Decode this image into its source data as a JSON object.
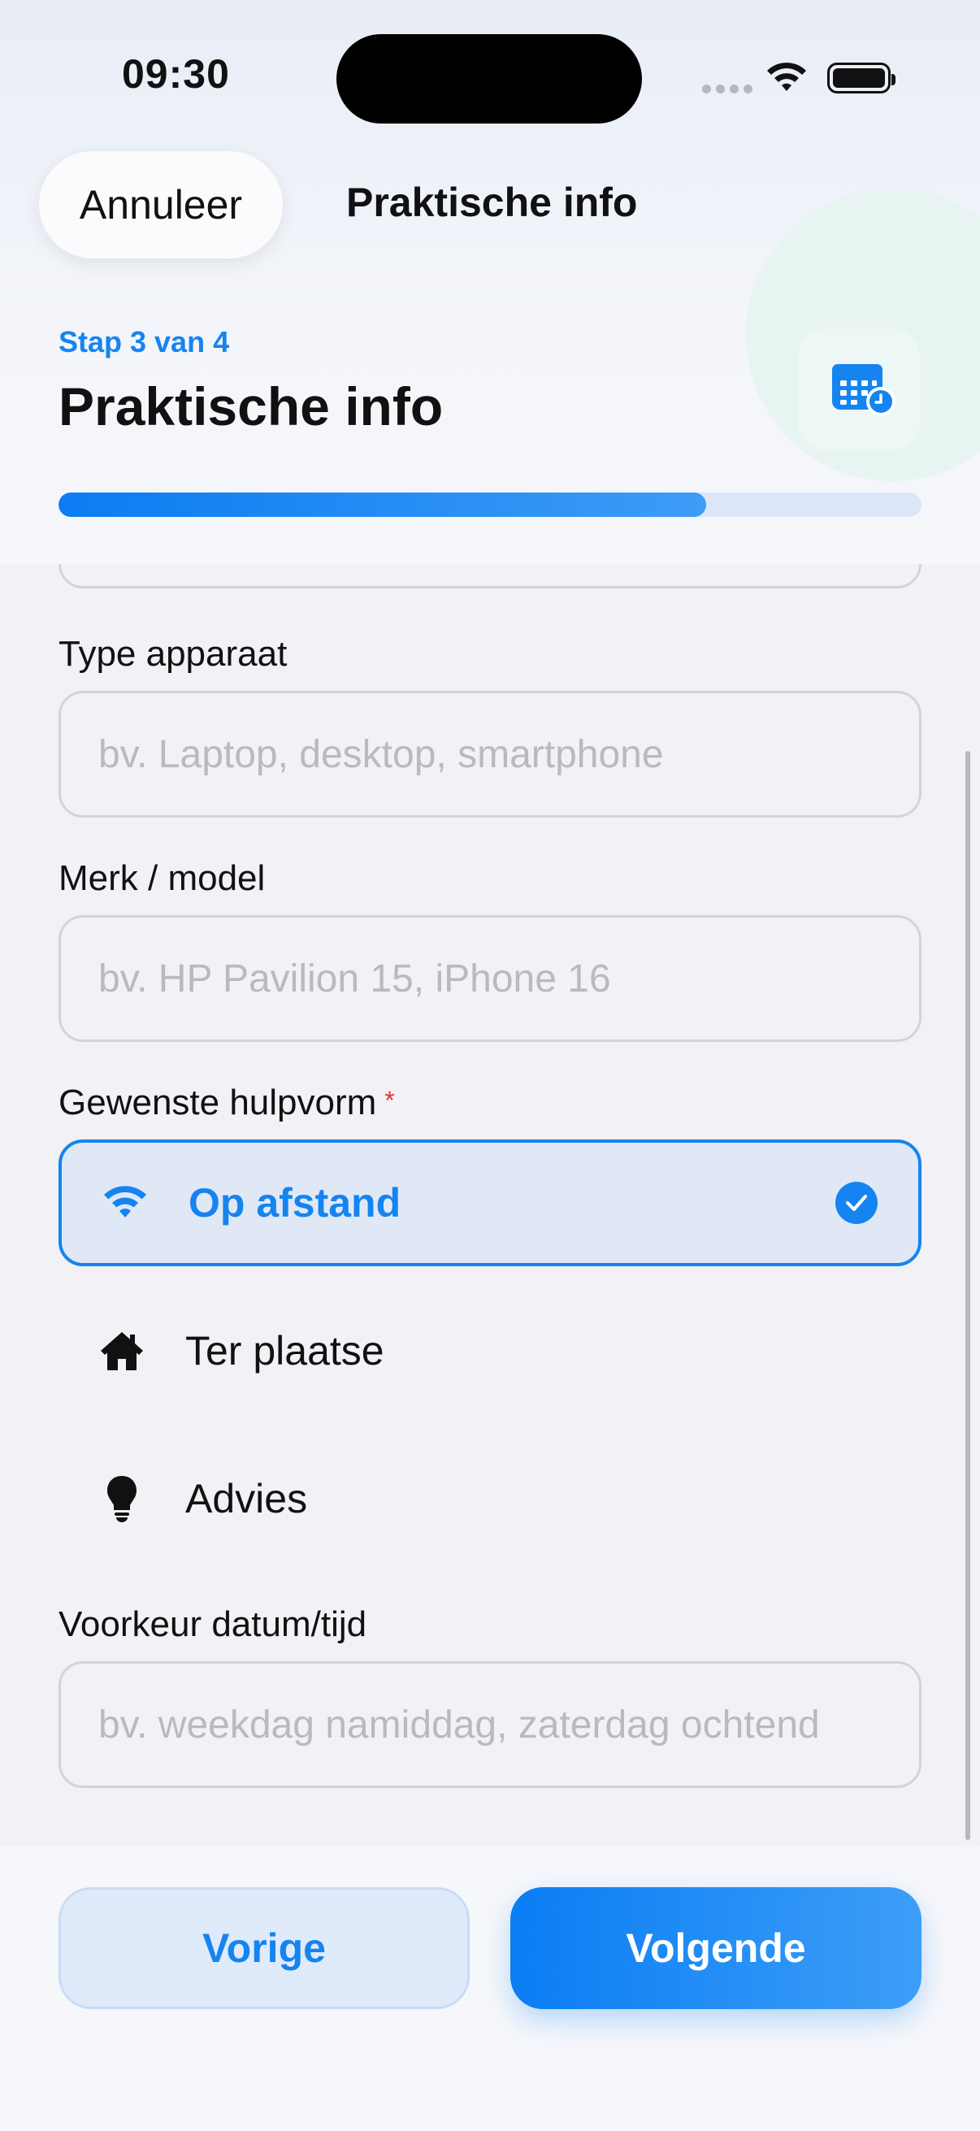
{
  "status_bar": {
    "time": "09:30"
  },
  "nav": {
    "cancel_label": "Annuleer",
    "title": "Praktische info"
  },
  "header": {
    "step_label": "Stap 3 van 4",
    "page_title": "Praktische info",
    "progress_fraction": 0.75,
    "icon": "calendar-clock-icon",
    "accent_color": "#1584F0"
  },
  "form": {
    "device_type": {
      "label": "Type apparaat",
      "placeholder": "bv. Laptop, desktop, smartphone",
      "value": ""
    },
    "brand_model": {
      "label": "Merk / model",
      "placeholder": "bv. HP Pavilion 15, iPhone 16",
      "value": ""
    },
    "help_type": {
      "label": "Gewenste hulpvorm",
      "required_marker": "*",
      "options": [
        {
          "label": "Op afstand",
          "icon": "wifi-icon",
          "selected": true
        },
        {
          "label": "Ter plaatse",
          "icon": "house-icon",
          "selected": false
        },
        {
          "label": "Advies",
          "icon": "lightbulb-icon",
          "selected": false
        }
      ]
    },
    "preferred_time": {
      "label": "Voorkeur datum/tijd",
      "placeholder": "bv. weekdag namiddag, zaterdag ochtend",
      "value": ""
    }
  },
  "footer": {
    "prev_label": "Vorige",
    "next_label": "Volgende"
  }
}
